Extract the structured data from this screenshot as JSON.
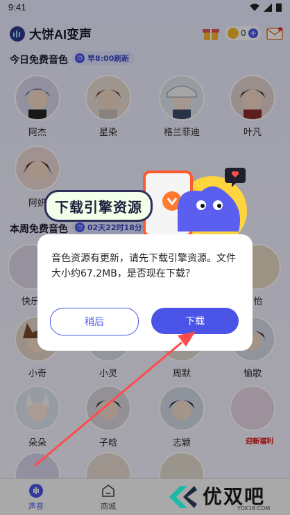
{
  "status_bar": {
    "time": "9:41"
  },
  "header": {
    "title": "大饼AI变声",
    "coins": "0"
  },
  "free_today": {
    "title": "今日免费音色",
    "badge": "早8:00刷新",
    "voices": [
      {
        "name": "阿杰"
      },
      {
        "name": "星染"
      },
      {
        "name": "格兰菲迪"
      },
      {
        "name": "叶凡"
      },
      {
        "name": "阿妍"
      }
    ]
  },
  "free_week": {
    "title": "本周免费音色",
    "badge": "02天22时18分",
    "voices": [
      {
        "name": "快乐"
      },
      {
        "name": "怡"
      },
      {
        "name": "小奇"
      },
      {
        "name": "小灵"
      },
      {
        "name": "周默"
      },
      {
        "name": "愉歌"
      },
      {
        "name": "朵朵"
      },
      {
        "name": "子晗"
      },
      {
        "name": "志颖"
      }
    ]
  },
  "promo": {
    "text": "下载引擎资源",
    "side_badge": "迎新福利"
  },
  "dialog": {
    "message": "音色资源有更新，请先下载引擎资源。文件大小约67.2MB，是否现在下载？",
    "cancel_label": "稍后",
    "confirm_label": "下载"
  },
  "bottom_nav": {
    "items": [
      {
        "label": "声音"
      },
      {
        "label": "商城"
      }
    ]
  },
  "watermark": {
    "text": "优双吧",
    "url": "YOX18.COM"
  },
  "colors": {
    "accent": "#4a55e8",
    "overlay": "rgba(0,0,0,0.32)"
  }
}
